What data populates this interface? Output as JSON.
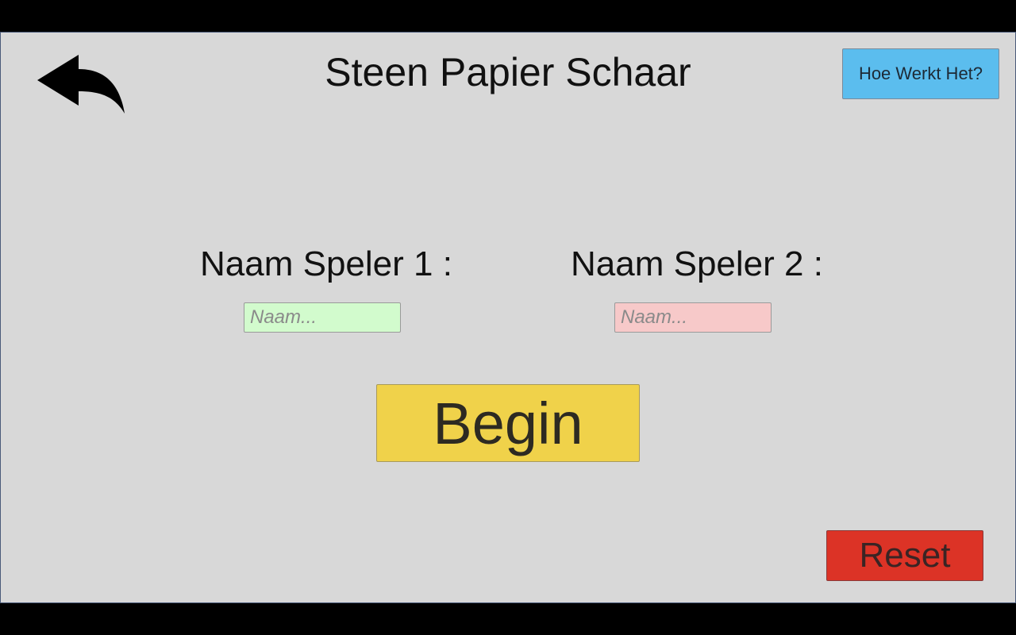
{
  "header": {
    "title": "Steen Papier Schaar",
    "back_icon": "back-arrow-icon",
    "help_label": "Hoe Werkt Het?"
  },
  "players": {
    "player1": {
      "label": "Naam Speler 1 :",
      "value": "",
      "placeholder": "Naam..."
    },
    "player2": {
      "label": "Naam Speler 2 :",
      "value": "",
      "placeholder": "Naam..."
    }
  },
  "actions": {
    "begin_label": "Begin",
    "reset_label": "Reset"
  },
  "colors": {
    "background": "#d8d8d8",
    "help_button": "#5bbdee",
    "player1_input": "#d2fbcd",
    "player2_input": "#f7c9c9",
    "begin_button": "#f0d24a",
    "reset_button": "#dc3326"
  }
}
